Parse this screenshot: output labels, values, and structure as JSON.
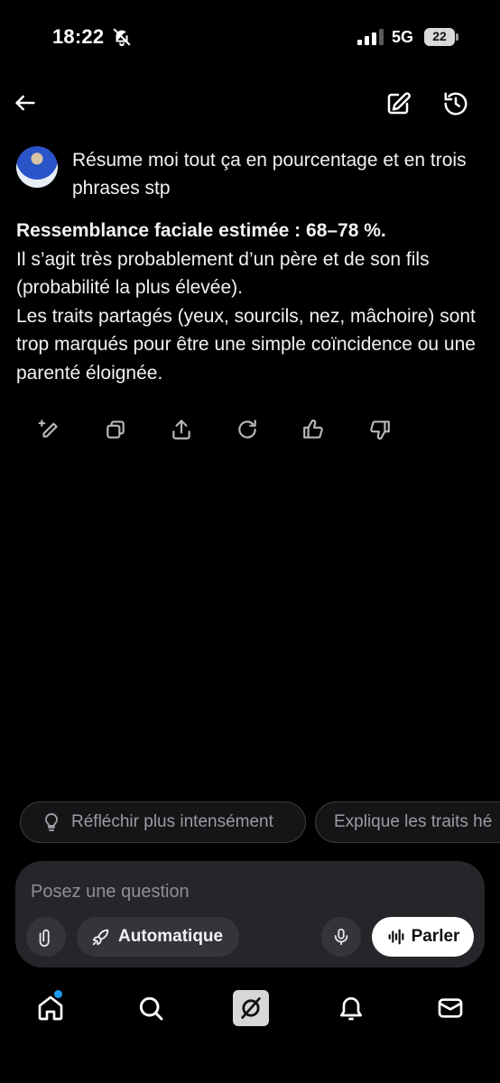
{
  "status_bar": {
    "time": "18:22",
    "network": "5G",
    "battery": "22",
    "icons": [
      "bell-off-icon",
      "signal-bars-icon",
      "battery-icon"
    ]
  },
  "top_bar": {
    "icons": [
      "back-arrow-icon",
      "new-chat-icon",
      "history-icon"
    ]
  },
  "conversation": {
    "user_message": "Résume moi tout ça en pourcentage et en trois phrases stp",
    "answer": {
      "headline": "Ressemblance faciale estimée : 68–78 %.",
      "line1": "Il s’agit très probablement d’un père et de son fils (probabilité la plus élevée).",
      "line2": "Les traits partagés (yeux, sourcils, nez, mâchoire) sont trop marqués pour être une simple coïncidence ou une parenté éloignée."
    },
    "actions": [
      "edit-sparkle-icon",
      "copy-icon",
      "share-icon",
      "regenerate-icon",
      "thumbs-up-icon",
      "thumbs-down-icon"
    ]
  },
  "suggestions": [
    {
      "label": "Réfléchir plus intensément",
      "icon": "lightbulb-icon"
    },
    {
      "label": "Explique les traits hé"
    }
  ],
  "composer": {
    "placeholder": "Posez une question",
    "mode_label": "Automatique",
    "speak_label": "Parler"
  },
  "bottom_nav": {
    "items": [
      "home-icon",
      "search-icon",
      "grok-icon",
      "notifications-icon",
      "messages-icon"
    ],
    "accent": "#1d9bf0"
  },
  "colors": {
    "background": "#000000",
    "surface": "#25262a",
    "chip_text": "#9b9ca1"
  }
}
